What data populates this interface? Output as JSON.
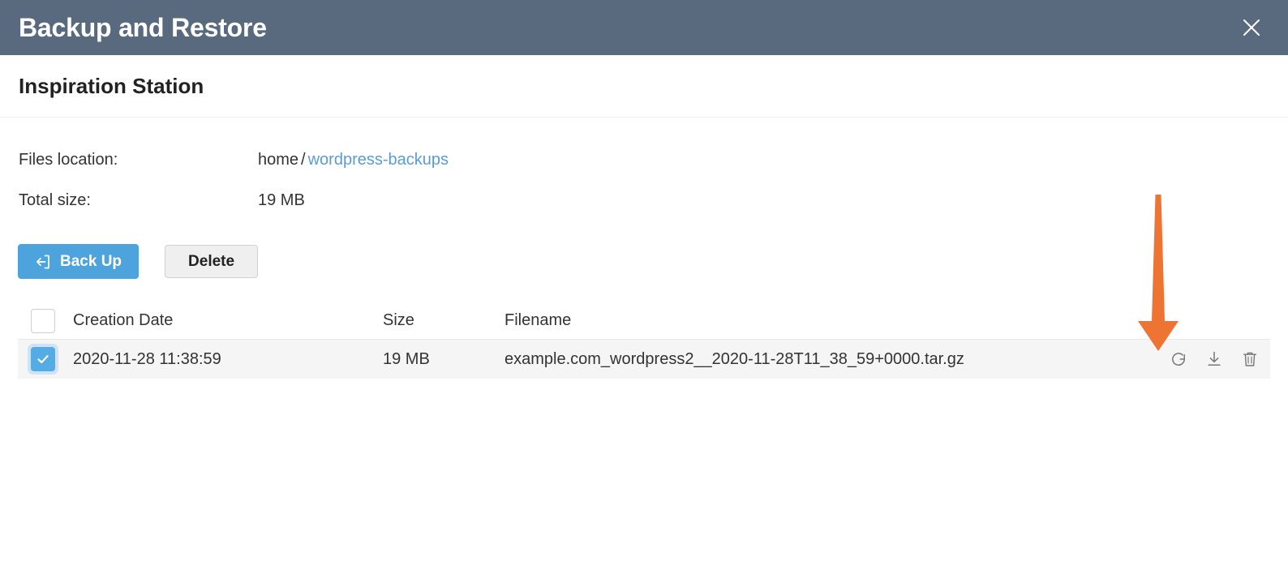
{
  "titlebar": {
    "title": "Backup and Restore",
    "close_icon": "close-icon"
  },
  "subheader": {
    "title": "Inspiration Station"
  },
  "info": {
    "rows": [
      {
        "label": "Files location:",
        "value_plain": "home",
        "separator": "/",
        "value_link": "wordpress-backups"
      },
      {
        "label": "Total size:",
        "value_plain": "19 MB"
      }
    ]
  },
  "toolbar": {
    "backup_label": "Back Up",
    "backup_icon": "backup-export-icon",
    "delete_label": "Delete"
  },
  "table": {
    "columns": {
      "creation_date": "Creation Date",
      "size": "Size",
      "filename": "Filename"
    },
    "header_checkbox_checked": false,
    "rows": [
      {
        "checked": true,
        "creation_date": "2020-11-28 11:38:59",
        "size": "19 MB",
        "filename": "example.com_wordpress2__2020-11-28T11_38_59+0000.tar.gz",
        "actions": [
          "restore-icon",
          "download-icon",
          "trash-icon"
        ]
      }
    ]
  },
  "annotation": {
    "arrow_color": "#ED7433",
    "points_to": "restore-icon"
  },
  "colors": {
    "titlebar_bg": "#5a6a7e",
    "primary_button": "#4da3db",
    "link": "#5b9bd5",
    "row_bg": "#f5f5f5",
    "checkbox_checked": "#55abe3",
    "annotation_orange": "#ED7433"
  }
}
